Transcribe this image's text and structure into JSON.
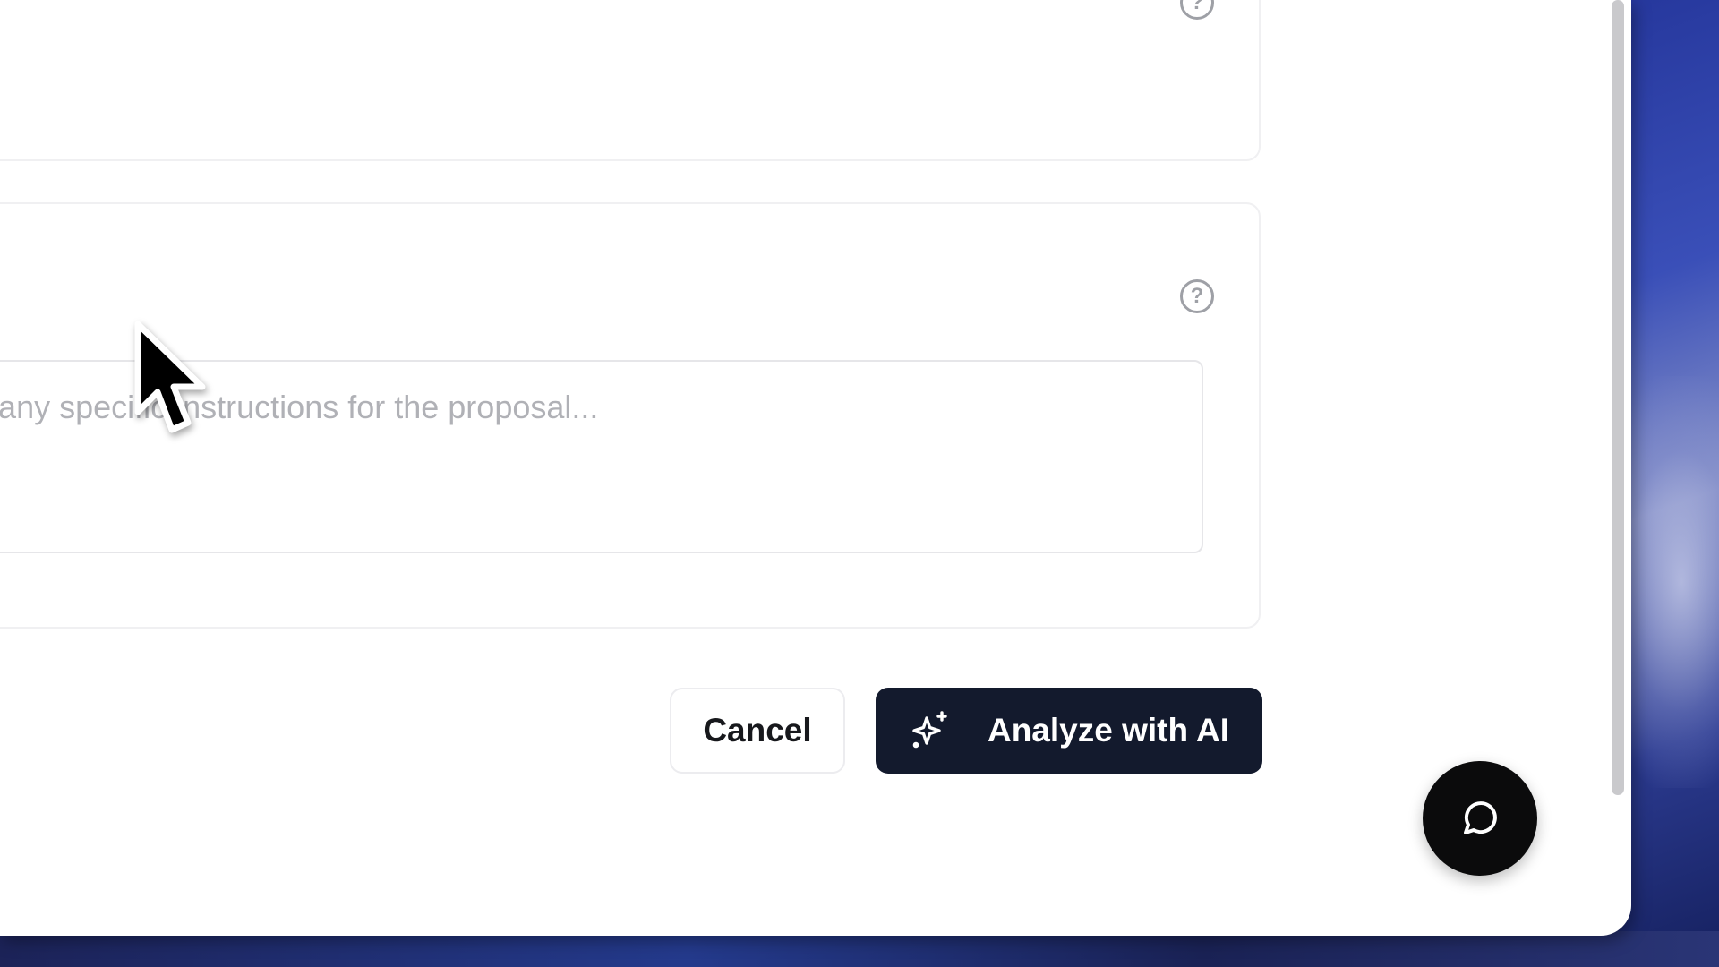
{
  "desktop": {
    "accent": "#24359a"
  },
  "notes_card": {
    "textarea_placeholder": "Add any specific instructions for the proposal..."
  },
  "actions": {
    "cancel_label": "Cancel",
    "analyze_label": "Analyze with AI",
    "analyze_icon": "sparkles-icon",
    "analyze_bg": "#131a2d"
  },
  "help": {
    "glyph": "?"
  },
  "chat": {
    "icon": "message-circle-icon",
    "bg": "#0b0b0c"
  }
}
